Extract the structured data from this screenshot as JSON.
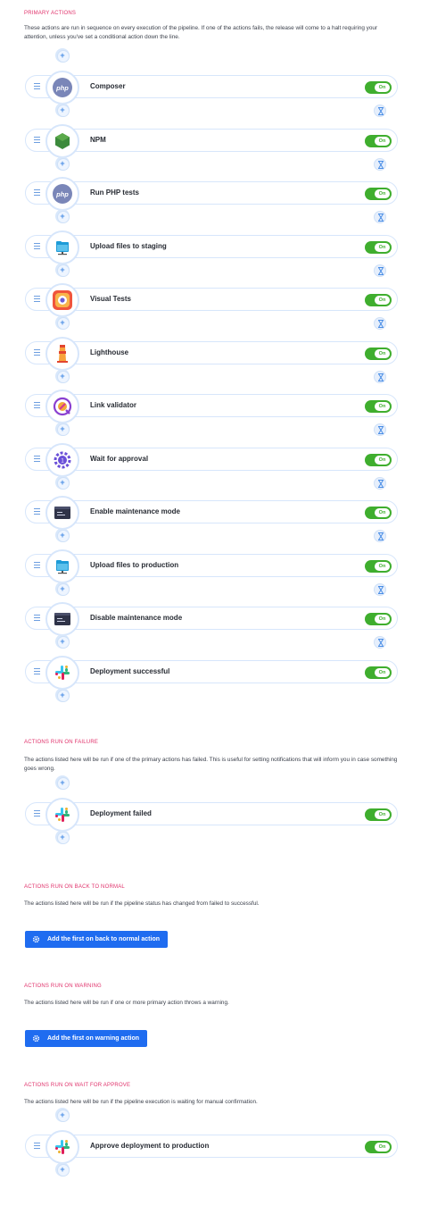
{
  "sections": {
    "primary": {
      "title": "PRIMARY ACTIONS",
      "description": "These actions are run in sequence on every execution of the pipeline. If one of the actions fails, the release will come to a halt requiring your attention, unless you've set a conditional action down the line."
    },
    "failure": {
      "title": "ACTIONS RUN ON FAILURE",
      "description": "The actions listed here will be run if one of the primary actions has failed. This is useful for setting notifications that will inform you in case something goes wrong."
    },
    "back_to_normal": {
      "title": "ACTIONS RUN ON BACK TO NORMAL",
      "description": "The actions listed here will be run if the pipeline status has changed from failed to successful.",
      "button_label": "Add the first on back to normal action"
    },
    "warning": {
      "title": "ACTIONS RUN ON WARNING",
      "description": "The actions listed here will be run if one or more primary action throws a warning.",
      "button_label": "Add the first on warning action"
    },
    "wait_for_approve": {
      "title": "ACTIONS RUN ON WAIT FOR APPROVE",
      "description": "The actions listed here will be run if the pipeline execution is waiting for manual confirmation."
    }
  },
  "toggle_label": "On",
  "primary_actions": [
    {
      "label": "Composer",
      "icon": "php-icon"
    },
    {
      "label": "NPM",
      "icon": "nodejs-icon"
    },
    {
      "label": "Run PHP tests",
      "icon": "php-icon"
    },
    {
      "label": "Upload files to staging",
      "icon": "folder-upload-icon"
    },
    {
      "label": "Visual Tests",
      "icon": "visual-tests-icon"
    },
    {
      "label": "Lighthouse",
      "icon": "lighthouse-icon"
    },
    {
      "label": "Link validator",
      "icon": "link-validator-icon"
    },
    {
      "label": "Wait for approval",
      "icon": "approval-gear-icon"
    },
    {
      "label": "Enable maintenance mode",
      "icon": "terminal-window-icon"
    },
    {
      "label": "Upload files to production",
      "icon": "folder-upload-icon"
    },
    {
      "label": "Disable maintenance mode",
      "icon": "terminal-window-icon"
    },
    {
      "label": "Deployment successful",
      "icon": "slack-icon"
    }
  ],
  "failure_actions": [
    {
      "label": "Deployment failed",
      "icon": "slack-icon"
    }
  ],
  "wait_for_approve_actions": [
    {
      "label": "Approve deployment to production",
      "icon": "slack-icon"
    }
  ],
  "colors": {
    "section_title": "#e0336c",
    "toggle_on": "#3fae2e",
    "button_bg": "#1f6cf0",
    "row_border": "#d7e6fb"
  }
}
